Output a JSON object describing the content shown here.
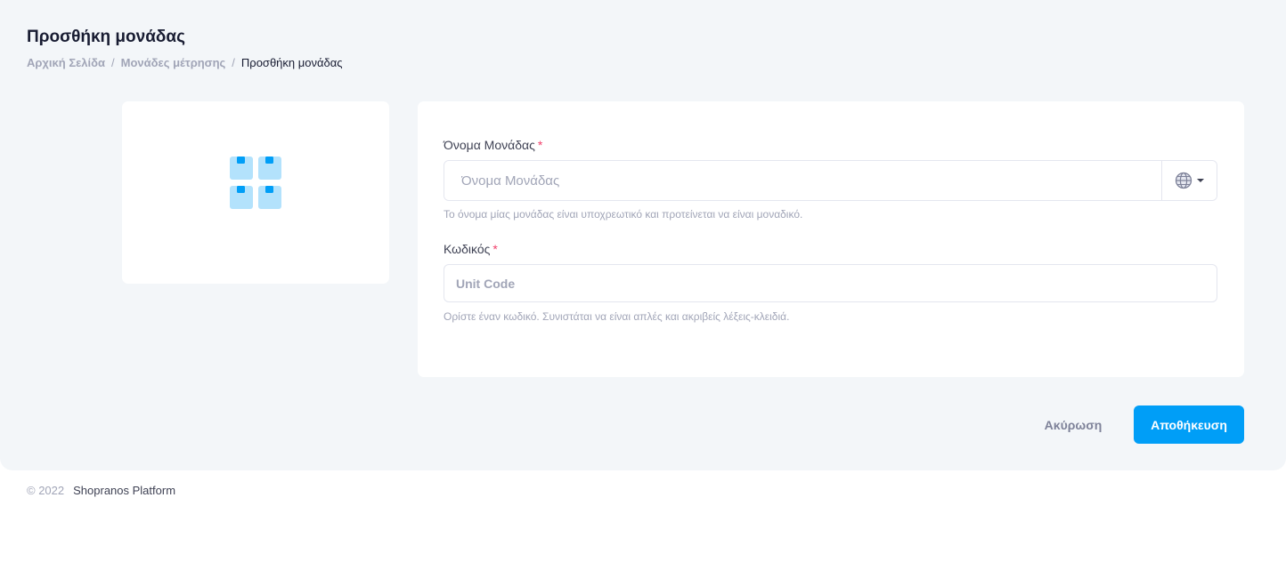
{
  "page": {
    "title": "Προσθήκη μονάδας"
  },
  "breadcrumb": {
    "home": "Αρχική Σελίδα",
    "units": "Μονάδες μέτρησης",
    "current": "Προσθήκη μονάδας",
    "separator": "/"
  },
  "image_card": {
    "icon": "units-grid-icon",
    "icon_colors": {
      "box": "#b3e2fc",
      "tab": "#009ef7"
    }
  },
  "form": {
    "name": {
      "label": "Όνομα Μονάδας",
      "required_mark": "*",
      "placeholder": "Όνομα Μονάδας",
      "value": "",
      "language_icon": "globe-icon",
      "help": "Το όνομα μίας μονάδας είναι υποχρεωτικό και προτείνεται να είναι μοναδικό."
    },
    "code": {
      "label": "Κωδικός",
      "required_mark": "*",
      "placeholder": "Unit Code",
      "value": "",
      "help": "Ορίστε έναν κωδικό. Συνιστάται να είναι απλές και ακριβείς λέξεις-κλειδιά."
    }
  },
  "actions": {
    "cancel_label": "Ακύρωση",
    "save_label": "Αποθήκευση"
  },
  "footer": {
    "copyright": "© 2022",
    "platform": "Shopranos Platform"
  },
  "colors": {
    "primary": "#009ef7",
    "required": "#f1416c",
    "background": "#f3f6f9",
    "muted_text": "#a1a5b7"
  }
}
